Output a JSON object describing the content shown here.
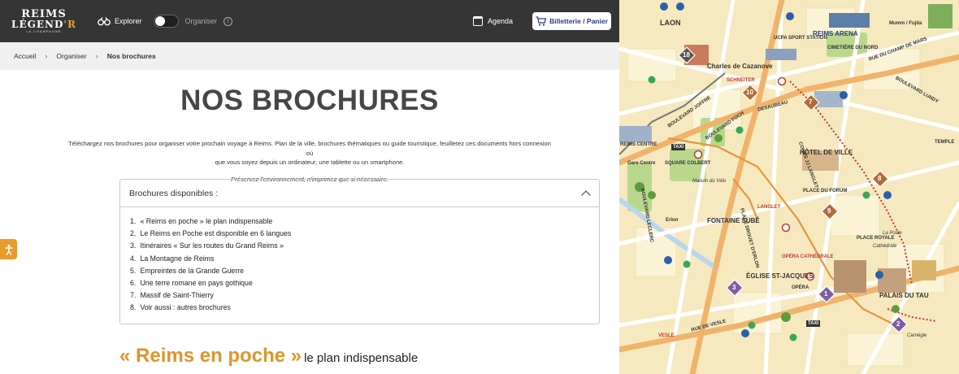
{
  "header": {
    "logo": {
      "line1": "REIMS",
      "line2": "LÉGEND",
      "line2_accent": "'R",
      "line3": "LA CHAMPAGNE"
    },
    "mode_left": "Explorer",
    "mode_right": "Organiser",
    "info_symbol": "i",
    "agenda": "Agenda",
    "billetterie": "Billetterie / Panier"
  },
  "breadcrumb": {
    "items": [
      "Accueil",
      "Organiser",
      "Nos brochures"
    ]
  },
  "page": {
    "title": "NOS BROCHURES",
    "intro_line1": "Téléchargez nos brochures pour organiser votre prochain voyage à Reims. Plan de la ville, brochures thématiques ou guide touristique, feuilletez ces documents hors connexion où",
    "intro_line2": "que vous soyez depuis un ordinateur, une tablette ou un smartphone.",
    "eco_note": "Préservez l'environnement, n'imprimez que si nécessaire."
  },
  "accordion": {
    "title": "Brochures disponibles :",
    "items": [
      {
        "num": "1.",
        "label": "« Reims en poche »  le plan indispensable"
      },
      {
        "num": "2.",
        "label": "Le Reims en Poche est disponible en 6 langues"
      },
      {
        "num": "3.",
        "label": "Itinéraires « Sur les routes du Grand Reims »"
      },
      {
        "num": "4.",
        "label": "La Montagne de Reims"
      },
      {
        "num": "5.",
        "label": "Empreintes de la Grande Guerre"
      },
      {
        "num": "6.",
        "label": "Une terre romane en pays gothique"
      },
      {
        "num": "7.",
        "label": "Massif de Saint-Thierry"
      },
      {
        "num": "8.",
        "label": "Voir aussi : autres brochures"
      }
    ]
  },
  "section": {
    "title": "« Reims en poche »",
    "subtitle": "le plan indispensable"
  },
  "map": {
    "labels": {
      "laon": "LAON",
      "reims_arena": "REIMS ARENA",
      "ucpa": "UCPA SPORT STATION",
      "cimetiere": "CIMETIÈRE DU NORD",
      "mumm": "Mumm / Fujita",
      "charles": "Charles de Cazanove",
      "schneiter": "SCHNEITER",
      "hotel_ville": "HÔTEL DE VILLE",
      "reims_centre": "REIMS CENTRE",
      "square_colbert": "SQUARE COLBERT",
      "fontaine": "FONTAINE SUBÉ",
      "langlet": "LANGLET",
      "opera": "OPÉRA",
      "opera_cathedrale": "OPÉRA CATHÉDRALE",
      "eglise": "ÉGLISE ST-JACQUES",
      "palais": "PALAIS DU TAU",
      "taxi1": "TAXI",
      "taxi2": "TAXI",
      "bd_joffre": "BOULEVARD JOFFRE",
      "bd_foch": "BOULEVARD FOCH",
      "bd_lundy": "BOULEVARD LUNDY",
      "desaubeau": "DESAUBEAU",
      "cours_langlet": "COURS JJ LANGLET",
      "place_drouet": "PLACE DROUET D'ERLON",
      "rue_vesle": "RUE DE VESLE",
      "vesle": "VESLE",
      "temple": "TEMPLE",
      "carnegie": "Carnégie",
      "gare": "Gare Centre",
      "champ_mars": "RUE DU CHAMP DE MARS",
      "cathedrale": "Cathédrale",
      "maison_velo": "Maison du Vélo",
      "erlon": "Erlon",
      "laposte": "La Poste",
      "place_royale": "PLACE ROYALE",
      "place_forum": "PLACE DU FORUM",
      "bd_leclerc": "BOULEVARD LECLERC"
    },
    "markers": [
      "18",
      "10",
      "7",
      "8",
      "9",
      "3",
      "1",
      "2"
    ]
  }
}
